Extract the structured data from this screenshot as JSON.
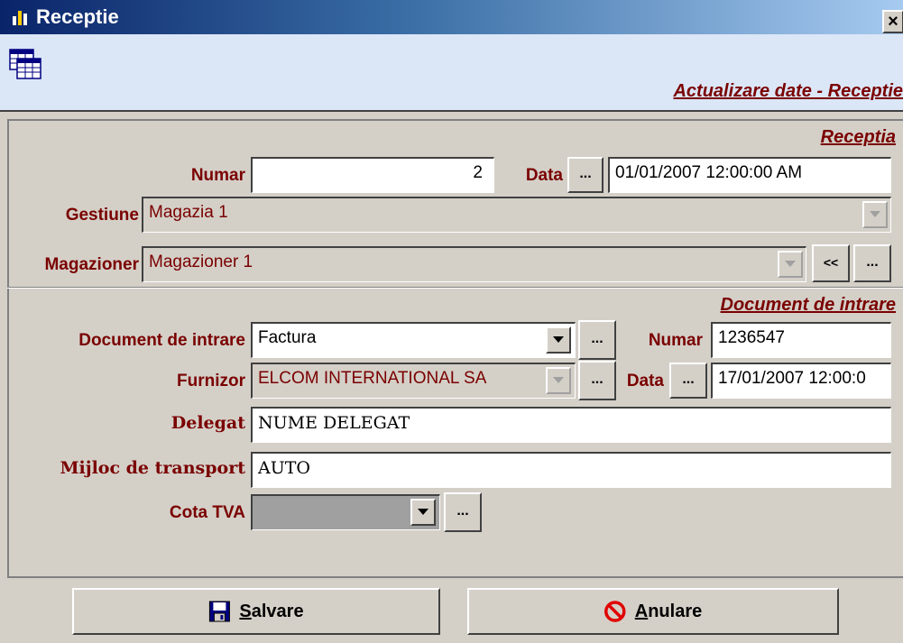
{
  "window": {
    "title": "Receptie",
    "close_label": "×"
  },
  "header": {
    "title": "Actualizare date - Receptie"
  },
  "receptia": {
    "section_title": "Receptia",
    "numar_label": "Numar",
    "numar_value": "2",
    "data_label": "Data",
    "data_button": "...",
    "data_value": "01/01/2007 12:00:00 AM",
    "gestiune_label": "Gestiune",
    "gestiune_value": "Magazia 1",
    "magazioner_label": "Magazioner",
    "magazioner_value": "Magazioner 1",
    "back_button": "<<",
    "browse_button": "..."
  },
  "document": {
    "section_title": "Document de intrare",
    "doc_label": "Document de intrare",
    "doc_value": "Factura",
    "doc_button": "...",
    "numar_label": "Numar",
    "numar_value": "1236547",
    "furnizor_label": "Furnizor",
    "furnizor_value": "ELCOM INTERNATIONAL SA",
    "furnizor_button": "...",
    "data_label": "Data",
    "data_button": "...",
    "data_value": "17/01/2007 12:00:0",
    "delegat_label": "Delegat",
    "delegat_value": "NUME DELEGAT",
    "transport_label": "Mijloc de transport",
    "transport_value": "AUTO",
    "tva_label": "Cota TVA",
    "tva_value": "",
    "tva_button": "..."
  },
  "actions": {
    "save_rest": "alvare",
    "save_accel": "S",
    "cancel_rest": "nulare",
    "cancel_accel": "A"
  },
  "icons": {
    "title_icon": "bar-chart-icon",
    "header_icon": "table-grid-icon",
    "save_icon": "floppy-disk-icon",
    "cancel_icon": "no-entry-icon"
  },
  "colors": {
    "title_bar_start": "#0a246a",
    "title_bar_end": "#a6caf0",
    "label_color": "#7a0000",
    "window_bg": "#d4d0c8",
    "header_bg": "#dbe6f7"
  }
}
